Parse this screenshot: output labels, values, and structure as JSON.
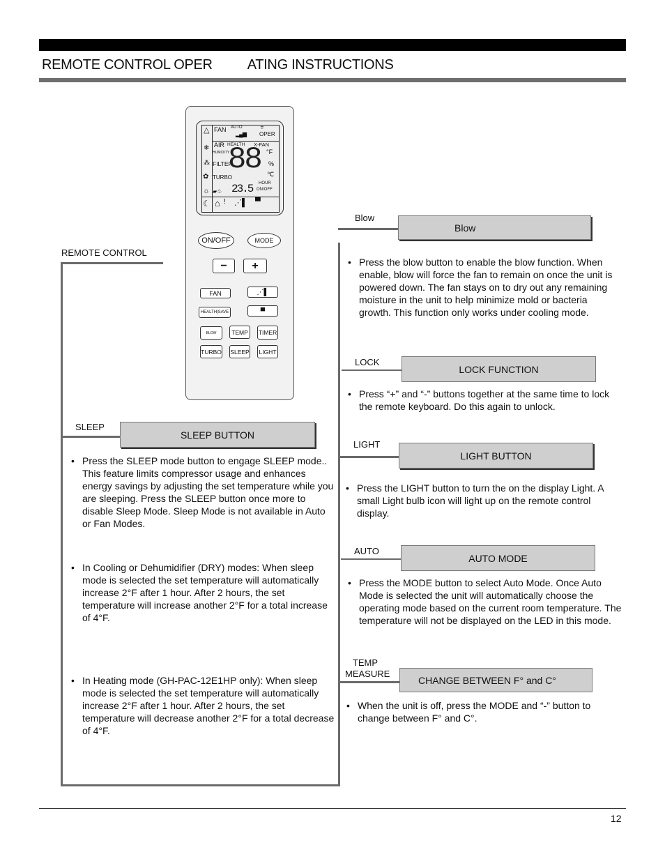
{
  "header": {
    "title_part1": "REMOTE CONTROL OPER",
    "title_part2": "ATING INSTRUCTIONS"
  },
  "remote_label": "REMOTE CONTROL",
  "remote": {
    "lcd": {
      "fan": "FAN",
      "auto": "AUTO",
      "oper": "OPER",
      "air": "AIR",
      "health": "HEALTH",
      "xfan": "X-FAN",
      "humidity": "HUMIDITY",
      "filter": "FILTER",
      "turbo": "TURBO",
      "big_digits": "88",
      "unit_f": "°F",
      "unit_pct": "%",
      "unit_c": "℃",
      "hour": "HOUR",
      "onoff": "ON/OFF",
      "small_digits": "23.5"
    },
    "buttons": {
      "onoff": "ON/OFF",
      "mode": "MODE",
      "minus": "−",
      "plus": "+",
      "fan": "FAN",
      "health_save": "HEALTH|SAVE",
      "blow": "BLOW",
      "temp": "TEMP",
      "timer": "TIMER",
      "turbo": "TURBO",
      "sleep": "SLEEP",
      "light": "LIGHT"
    }
  },
  "sections": {
    "sleep": {
      "tag": "SLEEP",
      "heading": "SLEEP BUTTON",
      "bullets": [
        "Press the SLEEP mode button to engage SLEEP mode.. This feature limits compressor usage and enhances energy savings by adjusting the set temperature while you are sleeping. Press the SLEEP button once more to disable Sleep Mode. Sleep Mode is not available in Auto or Fan Modes.",
        "In Cooling or Dehumidifier (DRY) modes:  When sleep mode is selected the set temperature will automatically increase 2°F after 1 hour. After 2 hours, the set temperature will increase another 2°F for a total increase of 4°F.",
        "In Heating mode (GH-PAC-12E1HP only):  When sleep mode is selected the set temperature will automatically increase 2°F after 1 hour. After 2 hours, the set temperature will decrease another 2°F for a total decrease of 4°F."
      ]
    },
    "blow": {
      "tag": "Blow",
      "heading": "Blow",
      "bullets": [
        "Press the blow button to enable the blow function. When enable, blow will force the fan to remain on once the unit is powered down. The fan stays on to dry out any remaining moisture in the unit to help minimize mold or bacteria growth. This function only works under cooling mode."
      ]
    },
    "lock": {
      "tag": "LOCK",
      "heading": "LOCK FUNCTION",
      "bullets": [
        "Press “+” and “-” buttons together at the same time to lock the remote keyboard. Do this again to unlock."
      ]
    },
    "light": {
      "tag": "LIGHT",
      "heading": "LIGHT BUTTON",
      "bullets": [
        "Press the LIGHT button to turn the on the display Light. A small Light bulb icon will light up on the remote control display."
      ]
    },
    "auto": {
      "tag": "AUTO",
      "heading": "AUTO MODE",
      "bullets": [
        "Press the MODE button to select Auto Mode. Once Auto Mode is selected the unit will automatically choose the operating mode based on the current room temperature. The temperature will not be displayed on the LED in this mode."
      ]
    },
    "temp": {
      "tag_line1": "TEMP",
      "tag_line2": "MEASURE",
      "heading": "CHANGE BETWEEN F° and C°",
      "bullets": [
        "When the unit is off, press the MODE and “-” button to change between F° and C°."
      ]
    }
  },
  "footer": {
    "page_number": "12"
  }
}
